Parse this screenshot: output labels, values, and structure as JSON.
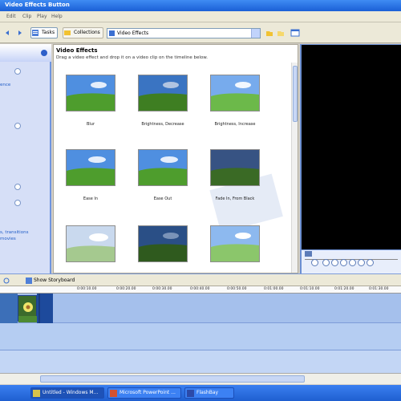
{
  "window": {
    "title": "Video Effects Button"
  },
  "menu": [
    "Edit",
    "Clip",
    "Play",
    "Help"
  ],
  "toolbar": {
    "tasks_label": "Tasks",
    "collections_label": "Collections",
    "location_value": "Video Effects"
  },
  "task_pane": {
    "links": [
      "ence",
      "s, transitions",
      "movies"
    ]
  },
  "content": {
    "heading": "Video Effects",
    "subtitle": "Drag a video effect and drop it on a video clip on the timeline below.",
    "effects": [
      {
        "label": "Blur"
      },
      {
        "label": "Brightness, Decrease"
      },
      {
        "label": "Brightness, Increase"
      },
      {
        "label": "Ease In"
      },
      {
        "label": "Ease Out"
      },
      {
        "label": "Fade In, From Black"
      },
      {
        "label": ""
      },
      {
        "label": ""
      },
      {
        "label": ""
      }
    ]
  },
  "timeline": {
    "toolbar_label": "Show Storyboard",
    "ruler": [
      "0:00:10.00",
      "0:00:20.00",
      "0:00:30.00",
      "0:00:40.00",
      "0:00:50.00",
      "0:01:00.00",
      "0:01:10.00",
      "0:01:20.00",
      "0:01:30.00"
    ]
  },
  "taskbar": {
    "tasks": [
      {
        "label": "Untitled - Windows M...",
        "active": true
      },
      {
        "label": "Microsoft PowerPoint ...",
        "active": false
      },
      {
        "label": "FlashBay",
        "active": false
      }
    ]
  }
}
